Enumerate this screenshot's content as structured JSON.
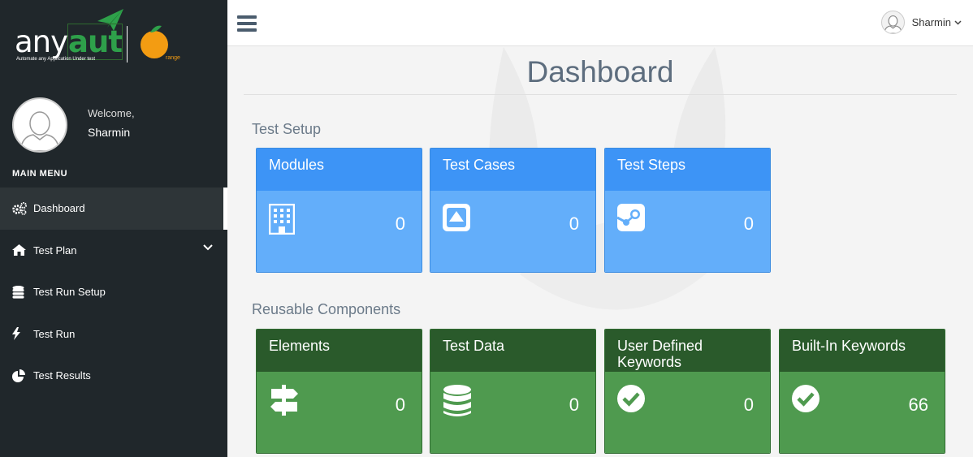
{
  "brand": {
    "name_prefix": "any",
    "name_suffix": "aut",
    "tagline": "Automate any Application Under test",
    "partner": "range"
  },
  "profile": {
    "welcome": "Welcome,",
    "name": "Sharmin"
  },
  "sidebar": {
    "menu_title": "MAIN MENU",
    "items": [
      {
        "label": "Dashboard",
        "icon": "gears-icon",
        "active": true
      },
      {
        "label": "Test Plan",
        "icon": "home-icon",
        "expandable": true
      },
      {
        "label": "Test Run Setup",
        "icon": "database-icon"
      },
      {
        "label": "Test Run",
        "icon": "bolt-icon"
      },
      {
        "label": "Test Results",
        "icon": "pie-chart-icon"
      }
    ]
  },
  "topbar": {
    "user_name": "Sharmin"
  },
  "main": {
    "title": "Dashboard",
    "sections": [
      {
        "title": "Test Setup",
        "cards": [
          {
            "label": "Modules",
            "count": "0",
            "icon": "building-icon"
          },
          {
            "label": "Test Cases",
            "count": "0",
            "icon": "caret-square-up-icon"
          },
          {
            "label": "Test Steps",
            "count": "0",
            "icon": "steam-icon"
          }
        ]
      },
      {
        "title": "Reusable Components",
        "cards": [
          {
            "label": "Elements",
            "count": "0",
            "icon": "signpost-icon"
          },
          {
            "label": "Test Data",
            "count": "0",
            "icon": "database-icon"
          },
          {
            "label": "User Defined Keywords",
            "count": "0",
            "icon": "check-circle-icon"
          },
          {
            "label": "Built-In Keywords",
            "count": "66",
            "icon": "check-circle-icon"
          }
        ]
      }
    ]
  },
  "colors": {
    "sidebar_bg": "#20272b",
    "blue_header": "#3d94f6",
    "blue_body": "#63aefa",
    "green_header": "#2a5a2b",
    "green_body": "#4f9a4f",
    "brand_green": "#2ea04a",
    "brand_orange": "#f39c12"
  }
}
